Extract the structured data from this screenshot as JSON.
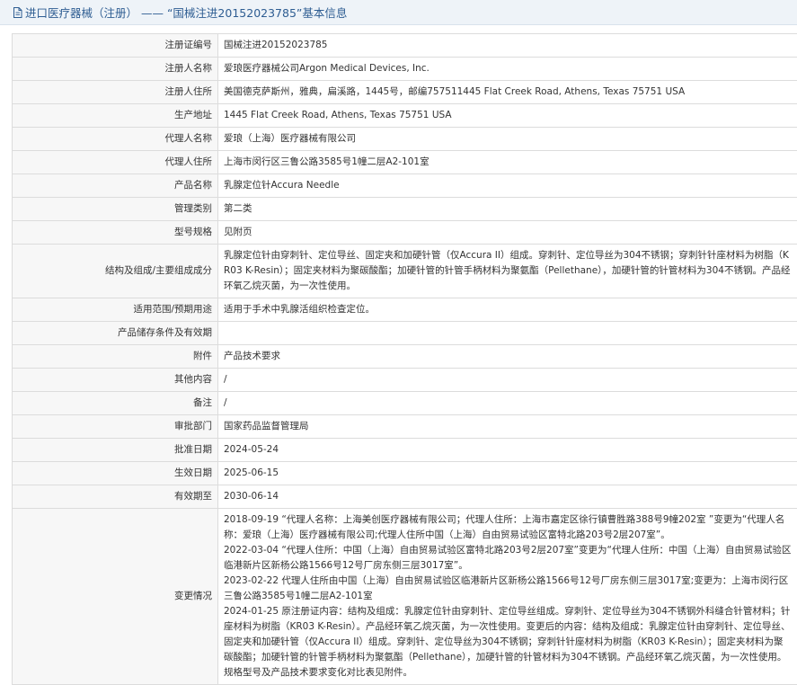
{
  "header": {
    "title": "进口医疗器械（注册） —— “国械注进20152023785”基本信息"
  },
  "rows": [
    {
      "label": "注册证编号",
      "value": "国械注进20152023785"
    },
    {
      "label": "注册人名称",
      "value": "爱琅医疗器械公司Argon Medical Devices, Inc."
    },
    {
      "label": "注册人住所",
      "value": "美国德克萨斯州，雅典，扁溪路，1445号，邮编757511445 Flat Creek Road, Athens, Texas 75751 USA"
    },
    {
      "label": "生产地址",
      "value": "1445 Flat Creek Road, Athens, Texas 75751 USA"
    },
    {
      "label": "代理人名称",
      "value": "爱琅（上海）医疗器械有限公司"
    },
    {
      "label": "代理人住所",
      "value": "上海市闵行区三鲁公路3585号1幢二层A2-101室"
    },
    {
      "label": "产品名称",
      "value": "乳腺定位针Accura Needle"
    },
    {
      "label": "管理类别",
      "value": "第二类"
    },
    {
      "label": "型号规格",
      "value": "见附页"
    },
    {
      "label": "结构及组成/主要组成成分",
      "value": "乳腺定位针由穿刺针、定位导丝、固定夹和加硬针管（仅Accura II）组成。穿刺针、定位导丝为304不锈钢；穿刺针针座材料为树脂（KR03 K-Resin）；固定夹材料为聚碳酸酯；加硬针管的针管手柄材料为聚氨酯（Pellethane），加硬针管的针管材料为304不锈钢。产品经环氧乙烷灭菌，为一次性使用。"
    },
    {
      "label": "适用范围/预期用途",
      "value": "适用于手术中乳腺活组织检查定位。"
    },
    {
      "label": "产品储存条件及有效期",
      "value": ""
    },
    {
      "label": "附件",
      "value": "产品技术要求"
    },
    {
      "label": "其他内容",
      "value": "/"
    },
    {
      "label": "备注",
      "value": "/"
    },
    {
      "label": "审批部门",
      "value": "国家药品监督管理局"
    },
    {
      "label": "批准日期",
      "value": "2024-05-24"
    },
    {
      "label": "生效日期",
      "value": "2025-06-15"
    },
    {
      "label": "有效期至",
      "value": "2030-06-14"
    }
  ],
  "changes": {
    "label": "变更情况",
    "entries": [
      "2018-09-19 “代理人名称：上海美创医疗器械有限公司；代理人住所：上海市嘉定区徐行镇曹胜路388号9幢202室 ”变更为“代理人名称：爱琅（上海）医疗器械有限公司;代理人住所中国（上海）自由贸易试验区富特北路203号2层207室”。",
      "2022-03-04 “代理人住所：中国（上海）自由贸易试验区富特北路203号2层207室”变更为“代理人住所：中国（上海）自由贸易试验区临港新片区新杨公路1566号12号厂房东侧三层3017室”。",
      "2023-02-22 代理人住所由中国（上海）自由贸易试验区临港新片区新杨公路1566号12号厂房东侧三层3017室;变更为：上海市闵行区三鲁公路3585号1幢二层A2-101室",
      "2024-01-25 原注册证内容：结构及组成：乳腺定位针由穿刺针、定位导丝组成。穿刺针、定位导丝为304不锈钢外科缝合针管材料；针座材料为树脂（KR03 K-Resin）。产品经环氧乙烷灭菌，为一次性使用。变更后的内容：结构及组成：乳腺定位针由穿刺针、定位导丝、固定夹和加硬针管（仅Accura II）组成。穿刺针、定位导丝为304不锈钢；穿刺针针座材料为树脂（KR03 K-Resin）；固定夹材料为聚碳酸酯；加硬针管的针管手柄材料为聚氨酯（Pellethane），加硬针管的针管材料为304不锈钢。产品经环氧乙烷灭菌，为一次性使用。规格型号及产品技术要求变化对比表见附件。"
    ]
  }
}
